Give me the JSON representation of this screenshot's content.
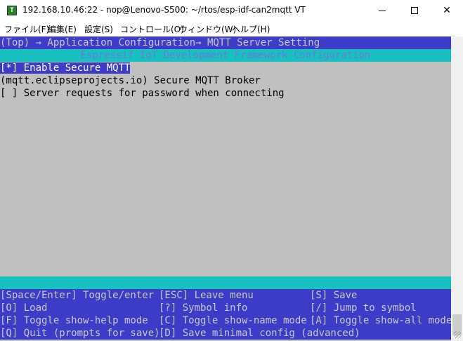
{
  "titlebar": {
    "app_icon": "T",
    "title": "192.168.10.46:22 - nop@Lenovo-S500: ~/rtos/esp-idf-can2mqtt VT",
    "minimize": "—",
    "maximize": "☐",
    "close": "✕"
  },
  "menubar": {
    "file": "ファイル(F)",
    "edit": "編集(E)",
    "setup": "設定(S)",
    "control": "コントロール(O)",
    "window": "ウィンドウ(W)",
    "help": "ヘルプ(H)"
  },
  "terminal": {
    "breadcrumb": "(Top) → Application Configuration→ MQTT Server Setting",
    "config_title": "Espressif IoT Development Framework Configuration",
    "options": [
      {
        "text": "[*] Enable Secure MQTT"
      },
      {
        "text": "(mqtt.eclipseprojects.io) Secure MQTT Broker"
      },
      {
        "text": "[ ] Server requests for password when connecting"
      }
    ],
    "help": {
      "r1c1": "[Space/Enter] Toggle/enter",
      "r1c2": "[ESC] Leave menu",
      "r1c3": "[S] Save",
      "r2c1": "[O] Load",
      "r2c2": "[?] Symbol info",
      "r2c3": "[/] Jump to symbol",
      "r3c1": "[F] Toggle show-help mode",
      "r3c2": "[C] Toggle show-name mode",
      "r3c3": "[A] Toggle show-all mode",
      "r4c1": "[Q] Quit (prompts for save)",
      "r4c2": "[D] Save minimal config (advanced)"
    }
  },
  "colors": {
    "terminal_bg": "#c0c0c0",
    "blue": "#3c3cc8",
    "cyan": "#18c0c0"
  },
  "icons": {
    "app": "terminal-app-icon",
    "minimize": "minimize-icon",
    "maximize": "maximize-icon",
    "close": "close-icon"
  }
}
